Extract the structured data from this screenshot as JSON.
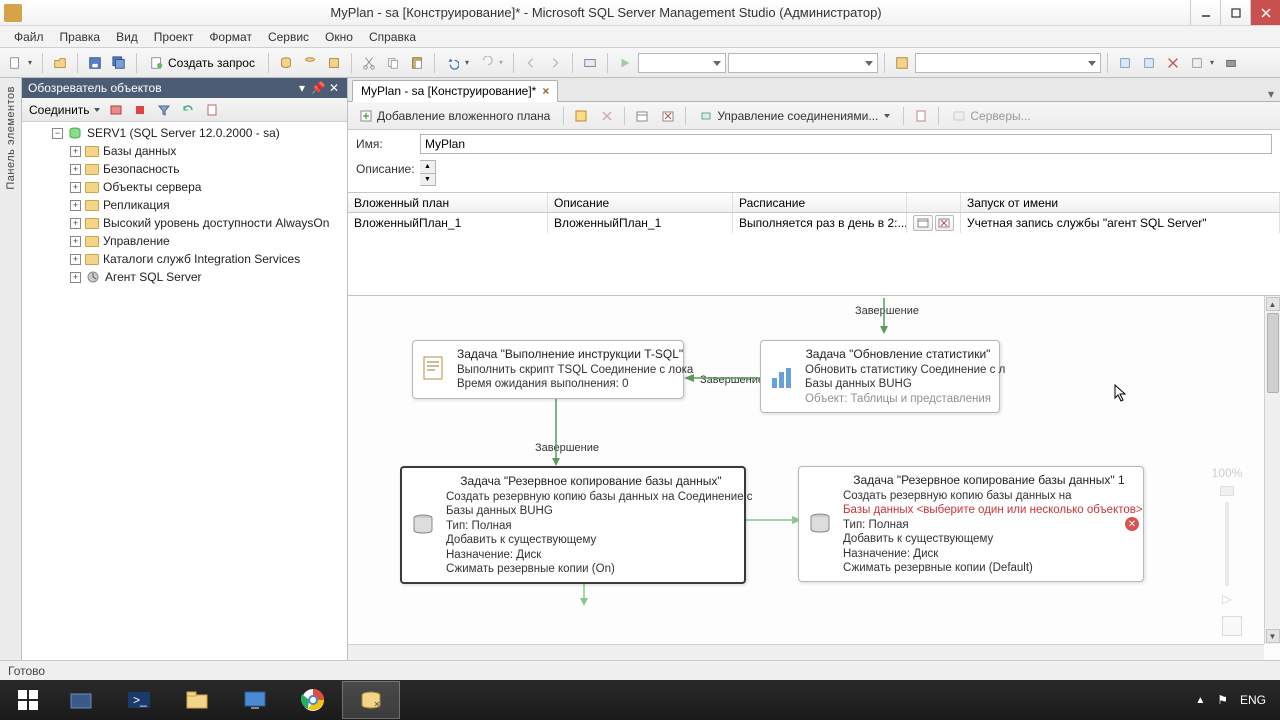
{
  "window": {
    "title": "MyPlan - sa [Конструирование]* - Microsoft SQL Server Management Studio (Администратор)"
  },
  "menubar": [
    "Файл",
    "Правка",
    "Вид",
    "Проект",
    "Формат",
    "Сервис",
    "Окно",
    "Справка"
  ],
  "toolbar": {
    "new_query": "Создать запрос"
  },
  "side_tab": "Панель элементов",
  "explorer": {
    "title": "Обозреватель объектов",
    "connect": "Соединить",
    "root": "SERV1 (SQL Server 12.0.2000 - sa)",
    "nodes": [
      "Базы данных",
      "Безопасность",
      "Объекты сервера",
      "Репликация",
      "Высокий уровень доступности AlwaysOn",
      "Управление",
      "Каталоги служб Integration Services",
      "Агент SQL Server"
    ]
  },
  "doc": {
    "tab": "MyPlan - sa [Конструирование]*",
    "toolbar": {
      "add_subplan": "Добавление вложенного плана",
      "manage_conn": "Управление соединениями...",
      "servers": "Серверы..."
    },
    "form": {
      "name_label": "Имя:",
      "name_value": "MyPlan",
      "desc_label": "Описание:"
    },
    "grid": {
      "cols": {
        "name": "Вложенный план",
        "desc": "Описание",
        "sched": "Расписание",
        "runas": "Запуск от имени"
      },
      "row": {
        "name": "ВложенныйПлан_1",
        "desc": "ВложенныйПлан_1",
        "sched": "Выполняется раз в день в 2:...",
        "runas": "Учетная запись службы \"агент SQL Server\""
      }
    },
    "tasks": {
      "top_label": "Завершение",
      "tsql": {
        "title": "Задача \"Выполнение инструкции T-SQL\"",
        "l1": "Выполнить скрипт TSQL Соединение с лока",
        "l2": "Время ожидания выполнения: 0"
      },
      "stats": {
        "title": "Задача \"Обновление статистики\"",
        "l1": "Обновить статистику Соединение с л",
        "l2": "Базы данных BUHG",
        "l3": "Объект: Таблицы и представления"
      },
      "mid_left_label": "Завершение",
      "mid_down_label": "Завершение",
      "backup1": {
        "title": "Задача \"Резервное копирование базы данных\"",
        "l1": "Создать резервную копию базы данных на Соединение с",
        "l2": "Базы данных BUHG",
        "l3": "Тип: Полная",
        "l4": "Добавить к существующему",
        "l5": "Назначение: Диск",
        "l6": "Сжимать резервные копии (On)"
      },
      "backup2": {
        "title": "Задача \"Резервное копирование базы данных\" 1",
        "l1": "Создать резервную копию базы данных на",
        "l2": "Базы данных <выберите один или несколько объектов>",
        "l3": "Тип: Полная",
        "l4": "Добавить к существующему",
        "l5": "Назначение: Диск",
        "l6": "Сжимать резервные копии (Default)"
      }
    },
    "zoom": "100%"
  },
  "statusbar": "Готово",
  "taskbar": {
    "lang": "ENG"
  }
}
